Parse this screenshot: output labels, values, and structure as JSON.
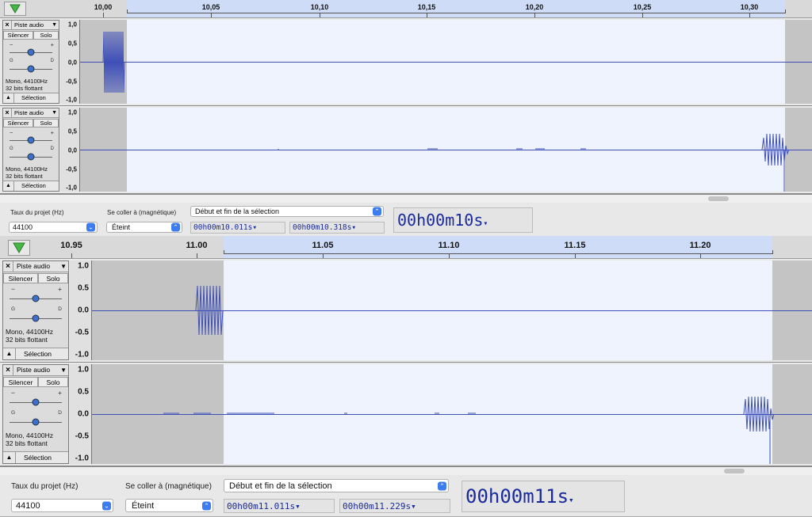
{
  "views": [
    {
      "ruler": {
        "ticks": [
          "10,00",
          "10,05",
          "10,10",
          "10,15",
          "10,20",
          "10,25",
          "10,30"
        ]
      },
      "tracks": [
        {
          "name": "Piste audio",
          "close": "×",
          "mute": "Silencer",
          "solo": "Solo",
          "gain_minus": "−",
          "gain_plus": "+",
          "pan_left": "G",
          "pan_right": "D",
          "format": "Mono, 44100Hz",
          "bits": "32 bits flottant",
          "select": "Sélection",
          "y_labels": [
            "1,0",
            "0,5",
            "0,0",
            "-0,5",
            "-1,0"
          ]
        },
        {
          "name": "Piste audio",
          "close": "×",
          "mute": "Silencer",
          "solo": "Solo",
          "gain_minus": "−",
          "gain_plus": "+",
          "pan_left": "G",
          "pan_right": "D",
          "format": "Mono, 44100Hz",
          "bits": "32 bits flottant",
          "select": "Sélection",
          "y_labels": [
            "1,0",
            "0,5",
            "0,0",
            "-0,5",
            "-1,0"
          ]
        }
      ],
      "status": {
        "rate_label": "Taux du projet (Hz)",
        "rate_value": "44100",
        "snap_label": "Se coller à (magnétique)",
        "snap_value": "Éteint",
        "sel_mode": "Début et fin de la sélection",
        "start_time": "00h00m10.011s",
        "end_time": "00h00m10.318s",
        "audio_pos": "00h00m10s"
      }
    },
    {
      "ruler": {
        "ticks": [
          "10.95",
          "11.00",
          "11.05",
          "11.10",
          "11.15",
          "11.20"
        ]
      },
      "tracks": [
        {
          "name": "Piste audio",
          "close": "×",
          "mute": "Silencer",
          "solo": "Solo",
          "gain_minus": "−",
          "gain_plus": "+",
          "pan_left": "G",
          "pan_right": "D",
          "format": "Mono, 44100Hz",
          "bits": "32 bits flottant",
          "select": "Sélection",
          "y_labels": [
            "1.0",
            "0.5",
            "0.0",
            "-0.5",
            "-1.0"
          ]
        },
        {
          "name": "Piste audio",
          "close": "×",
          "mute": "Silencer",
          "solo": "Solo",
          "gain_minus": "−",
          "gain_plus": "+",
          "pan_left": "G",
          "pan_right": "D",
          "format": "Mono, 44100Hz",
          "bits": "32 bits flottant",
          "select": "Sélection",
          "y_labels": [
            "1.0",
            "0.5",
            "0.0",
            "-0.5",
            "-1.0"
          ]
        }
      ],
      "status": {
        "rate_label": "Taux du projet (Hz)",
        "rate_value": "44100",
        "snap_label": "Se coller à (magnétique)",
        "snap_value": "Éteint",
        "sel_mode": "Début et fin de la sélection",
        "start_time": "00h00m11.011s",
        "end_time": "00h00m11.229s",
        "audio_pos": "00h00m11s"
      }
    }
  ],
  "icons": {
    "timeline_menu": "triangle-down-icon",
    "dropdown": "chevron-updown-icon",
    "collapse": "triangle-up-icon",
    "close": "close-icon"
  },
  "colors": {
    "waveform": "#3e4fb8",
    "selection": "#eef3fd",
    "timecode": "#1a2a9c",
    "accent": "#3d7cf0"
  }
}
